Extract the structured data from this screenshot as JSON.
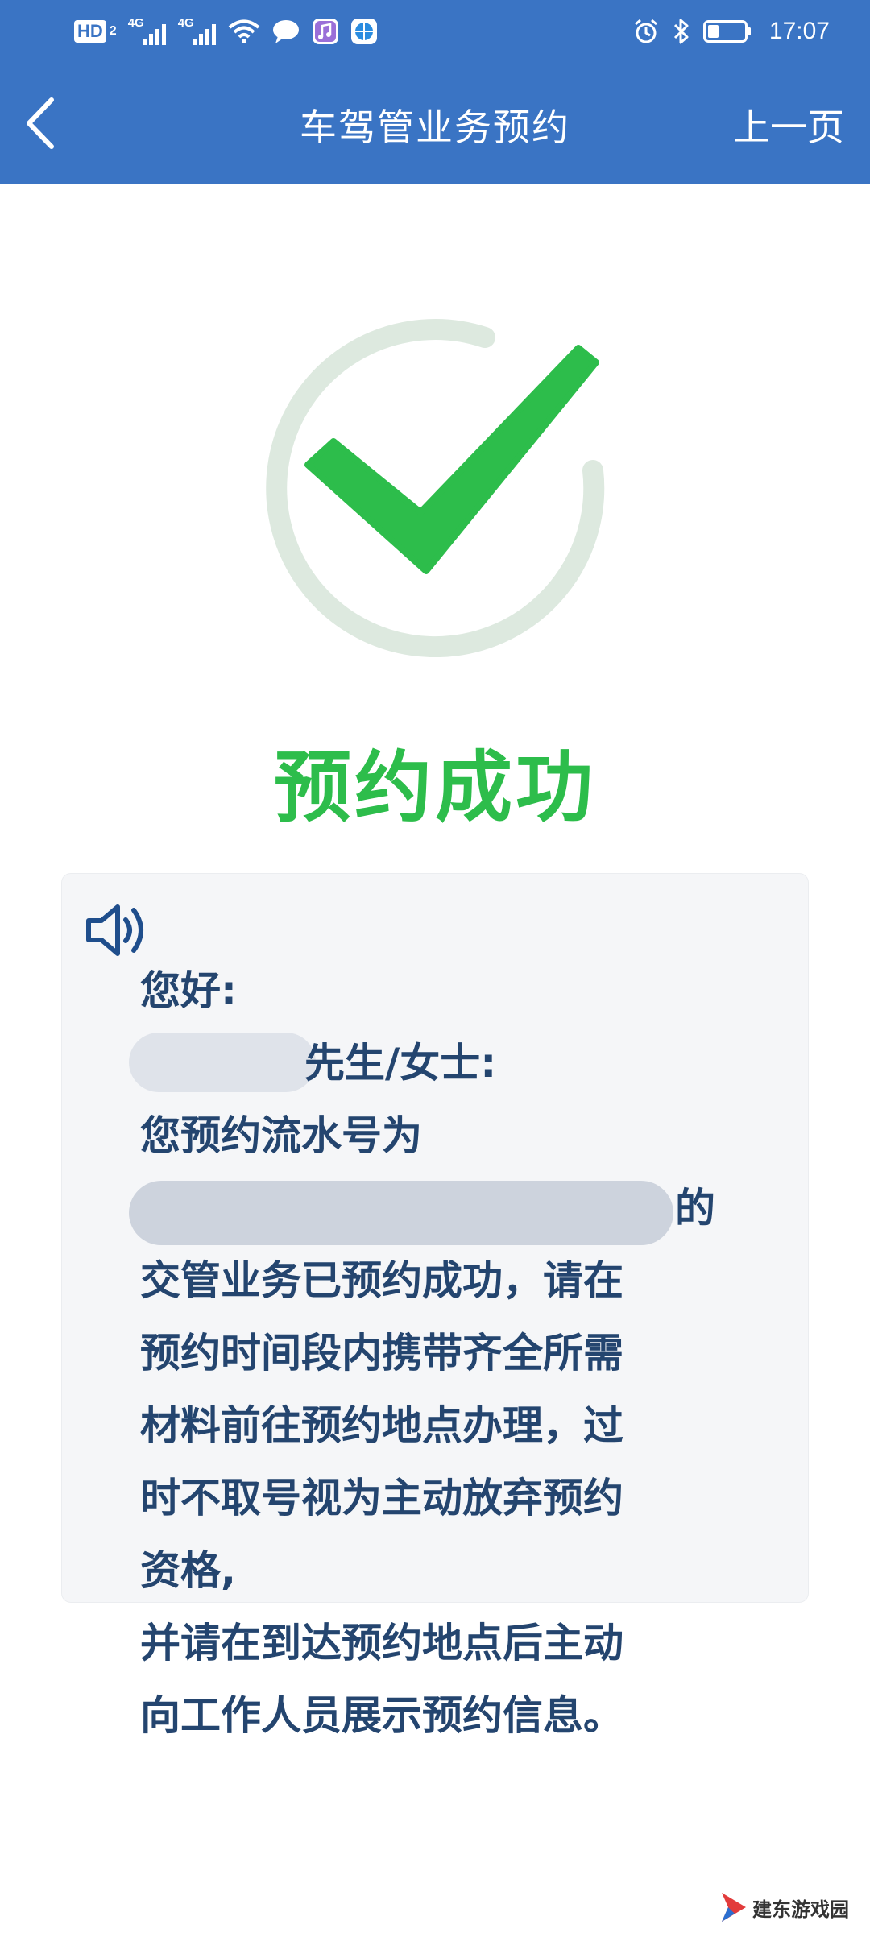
{
  "status_bar": {
    "hd_label": "HD",
    "hd_sub": "2",
    "network_1": "4G",
    "network_2": "4G",
    "time": "17:07",
    "icons": [
      "wifi-icon",
      "message-bubble-icon",
      "music-app-icon",
      "browser-app-icon",
      "alarm-icon",
      "bluetooth-icon",
      "battery-icon"
    ]
  },
  "nav": {
    "title": "车驾管业务预约",
    "prev_page": "上一页"
  },
  "result": {
    "title": "预约成功",
    "accent_color": "#2dbd4b"
  },
  "message": {
    "greeting": "您好:",
    "salutation_suffix": "先生/女士:",
    "line_serial": "您预约流水号为",
    "line_serial_suffix": "的",
    "line_1": "交管业务已预约成功，请在",
    "line_2": "预约时间段内携带齐全所需",
    "line_3": "材料前往预约地点办理，过",
    "line_4": "时不取号视为主动放弃预约",
    "line_5": "资格,",
    "line_6": "并请在到达预约地点后主动",
    "line_7": "向工作人员展示预约信息。"
  },
  "theme": {
    "header_bg": "#3a74c4",
    "text_color": "#24456f"
  },
  "watermark": {
    "text": "建东游戏园"
  }
}
